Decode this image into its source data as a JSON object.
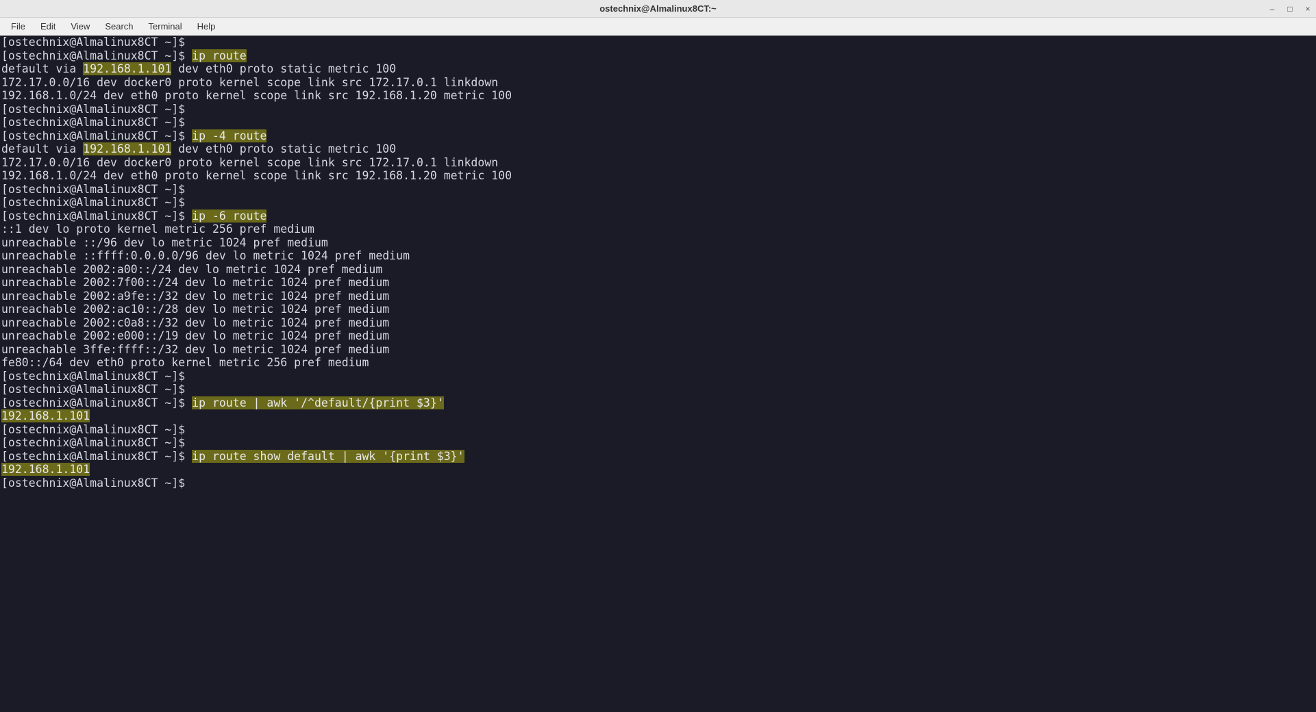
{
  "titlebar": {
    "title": "ostechnix@Almalinux8CT:~"
  },
  "window_controls": {
    "minimize": "–",
    "maximize": "□",
    "close": "×"
  },
  "menu": {
    "file": "File",
    "edit": "Edit",
    "view": "View",
    "search": "Search",
    "terminal": "Terminal",
    "help": "Help"
  },
  "prompt": "[ostechnix@Almalinux8CT ~]$ ",
  "cmd": {
    "ip_route": "ip route",
    "ip4_route": "ip -4 route",
    "ip6_route": "ip -6 route",
    "awk_default": "ip route | awk '/^default/{print $3}'",
    "awk_show_default": "ip route show default | awk '{print $3}'"
  },
  "out": {
    "default_pre": "default via ",
    "gateway_ip": "192.168.1.101",
    "default_post": " dev eth0 proto static metric 100",
    "docker_line": "172.17.0.0/16 dev docker0 proto kernel scope link src 172.17.0.1 linkdown",
    "lan_line": "192.168.1.0/24 dev eth0 proto kernel scope link src 192.168.1.20 metric 100",
    "v6_1": "::1 dev lo proto kernel metric 256 pref medium",
    "v6_2": "unreachable ::/96 dev lo metric 1024 pref medium",
    "v6_3": "unreachable ::ffff:0.0.0.0/96 dev lo metric 1024 pref medium",
    "v6_4": "unreachable 2002:a00::/24 dev lo metric 1024 pref medium",
    "v6_5": "unreachable 2002:7f00::/24 dev lo metric 1024 pref medium",
    "v6_6": "unreachable 2002:a9fe::/32 dev lo metric 1024 pref medium",
    "v6_7": "unreachable 2002:ac10::/28 dev lo metric 1024 pref medium",
    "v6_8": "unreachable 2002:c0a8::/32 dev lo metric 1024 pref medium",
    "v6_9": "unreachable 2002:e000::/19 dev lo metric 1024 pref medium",
    "v6_10": "unreachable 3ffe:ffff::/32 dev lo metric 1024 pref medium",
    "v6_11": "fe80::/64 dev eth0 proto kernel metric 256 pref medium",
    "result_ip": "192.168.1.101"
  }
}
